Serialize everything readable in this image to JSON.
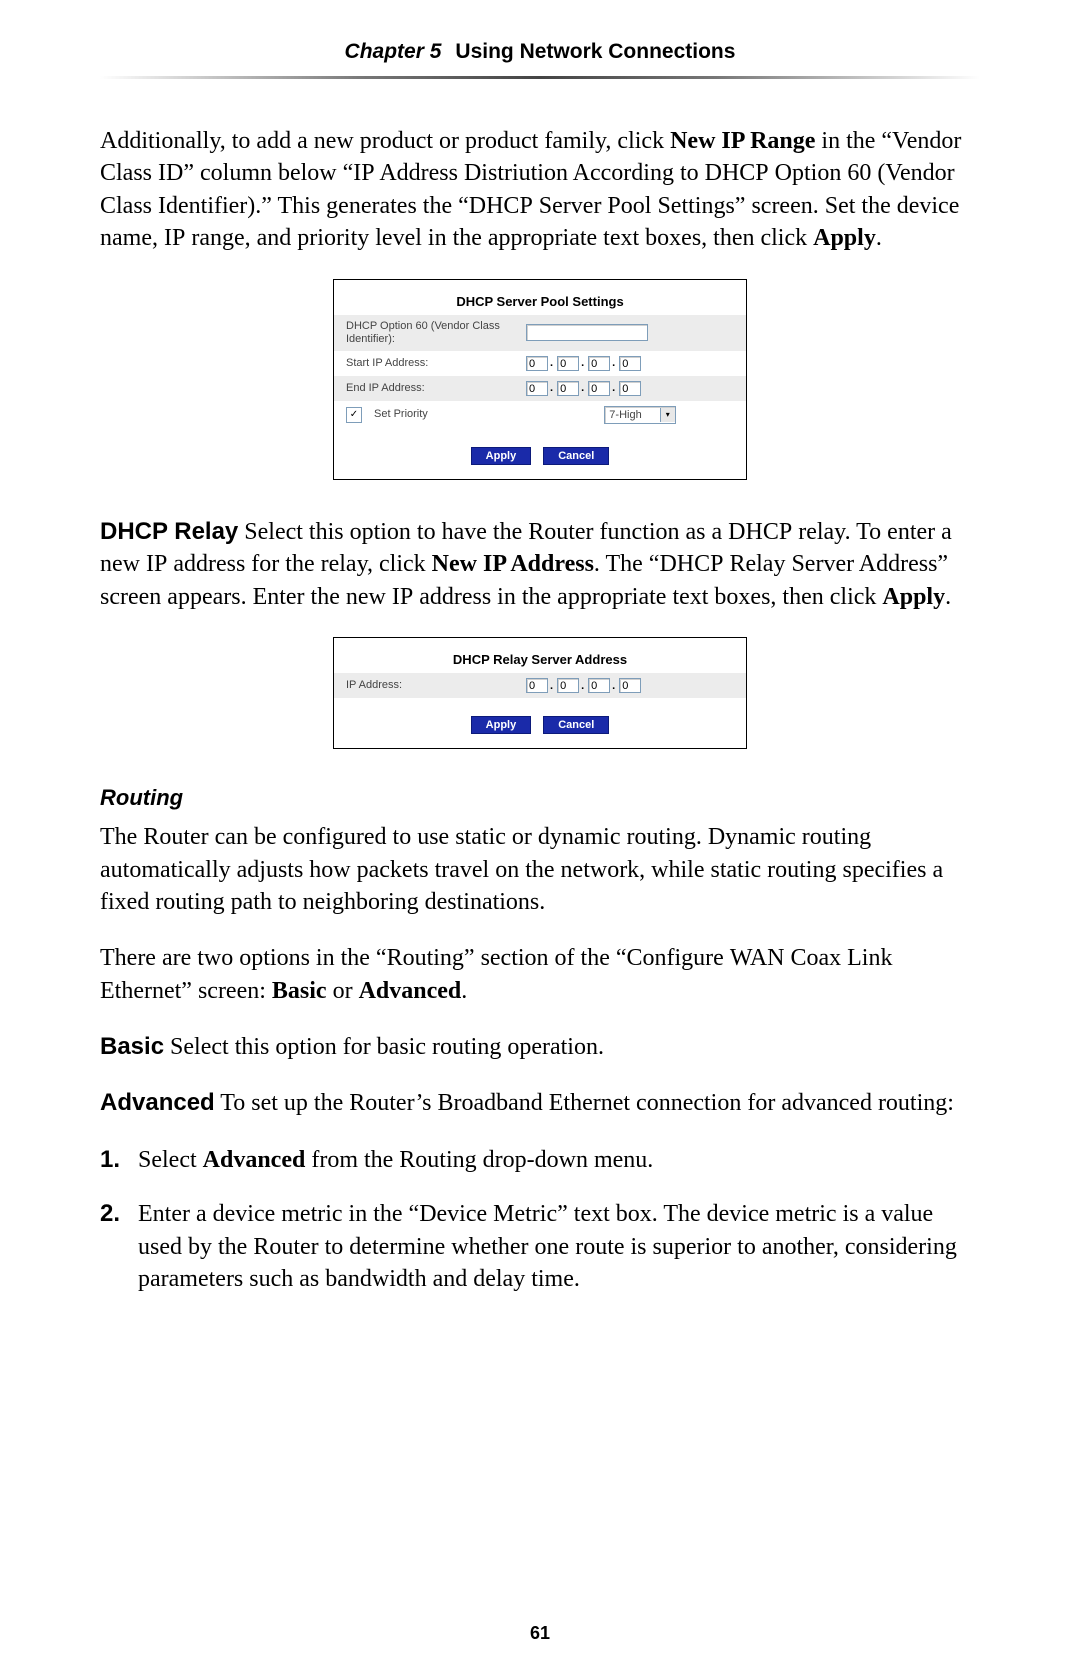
{
  "header": {
    "chapter_label": "Chapter 5",
    "chapter_title": "Using Network Connections"
  },
  "para1": {
    "pre": "Additionally, to add a new product or product family, click ",
    "b1": "New IP Range",
    "mid1": " in the “Vendor Class ",
    "sc1": "ID",
    "mid2": "” column below “",
    "sc2": "IP",
    "mid3": " Address Distriution According to ",
    "sc3": "DHCP",
    "mid4": " Option 60 (Vendor Class Identifier).” This generates the “",
    "sc4": "DHCP",
    "mid5": " Server Pool Settings” screen. Set the device name, ",
    "sc5": "IP",
    "mid6": " range, and priority level in the appropriate text boxes, then click ",
    "b2": "Apply",
    "end": "."
  },
  "fig1": {
    "title": "DHCP Server Pool Settings",
    "row1_label": "DHCP Option 60 (Vendor Class Identifier):",
    "row2_label": "Start IP Address:",
    "row3_label": "End IP Address:",
    "row4_label": "Set Priority",
    "octet": "0",
    "priority_option": "7-High",
    "btn_apply": "Apply",
    "btn_cancel": "Cancel"
  },
  "para2": {
    "runin": "DHCP Relay",
    "t1": "  Select this option to have the Router function as a ",
    "sc1": "DHCP",
    "t2": " relay. To enter a new ",
    "sc2": "IP",
    "t3": " address for the relay, click ",
    "b1": "New IP Address",
    "t4": ". The “",
    "sc3": "DHCP",
    "t5": " Relay Server Address” screen appears. Enter the new ",
    "sc4": "IP",
    "t6": " address in the appropriate text boxes, then click ",
    "b2": "Apply",
    "end": "."
  },
  "fig2": {
    "title": "DHCP Relay Server Address",
    "row1_label": "IP Address:",
    "octet": "0",
    "btn_apply": "Apply",
    "btn_cancel": "Cancel"
  },
  "routing": {
    "heading": "Routing",
    "p1": "The Router can be configured to use static or dynamic routing. Dynamic routing automatically adjusts how packets travel on the network, while static routing specifies a fixed routing path to neighboring destinations.",
    "p2_a": "There are two options in the “Routing” section of the “Configure ",
    "p2_sc": "WAN",
    "p2_b": " Coax Link Ethernet” screen: ",
    "p2_bold1": "Basic",
    "p2_or": " or ",
    "p2_bold2": "Advanced",
    "p2_end": ".",
    "basic_runin": "Basic",
    "basic_text": "  Select this option for basic routing operation.",
    "adv_runin": "Advanced",
    "adv_text": "  To set up the Router’s Broadband Ethernet connection for advanced routing:",
    "step1_num": "1.",
    "step1_a": "Select ",
    "step1_b": "Advanced",
    "step1_c": " from the Routing drop-down menu.",
    "step2_num": "2.",
    "step2": "Enter a device metric in the “Device Metric” text box. The device metric is a value used by the Router to determine whether one route is superior to another, considering parameters such as bandwidth and delay time."
  },
  "page_number": "61"
}
